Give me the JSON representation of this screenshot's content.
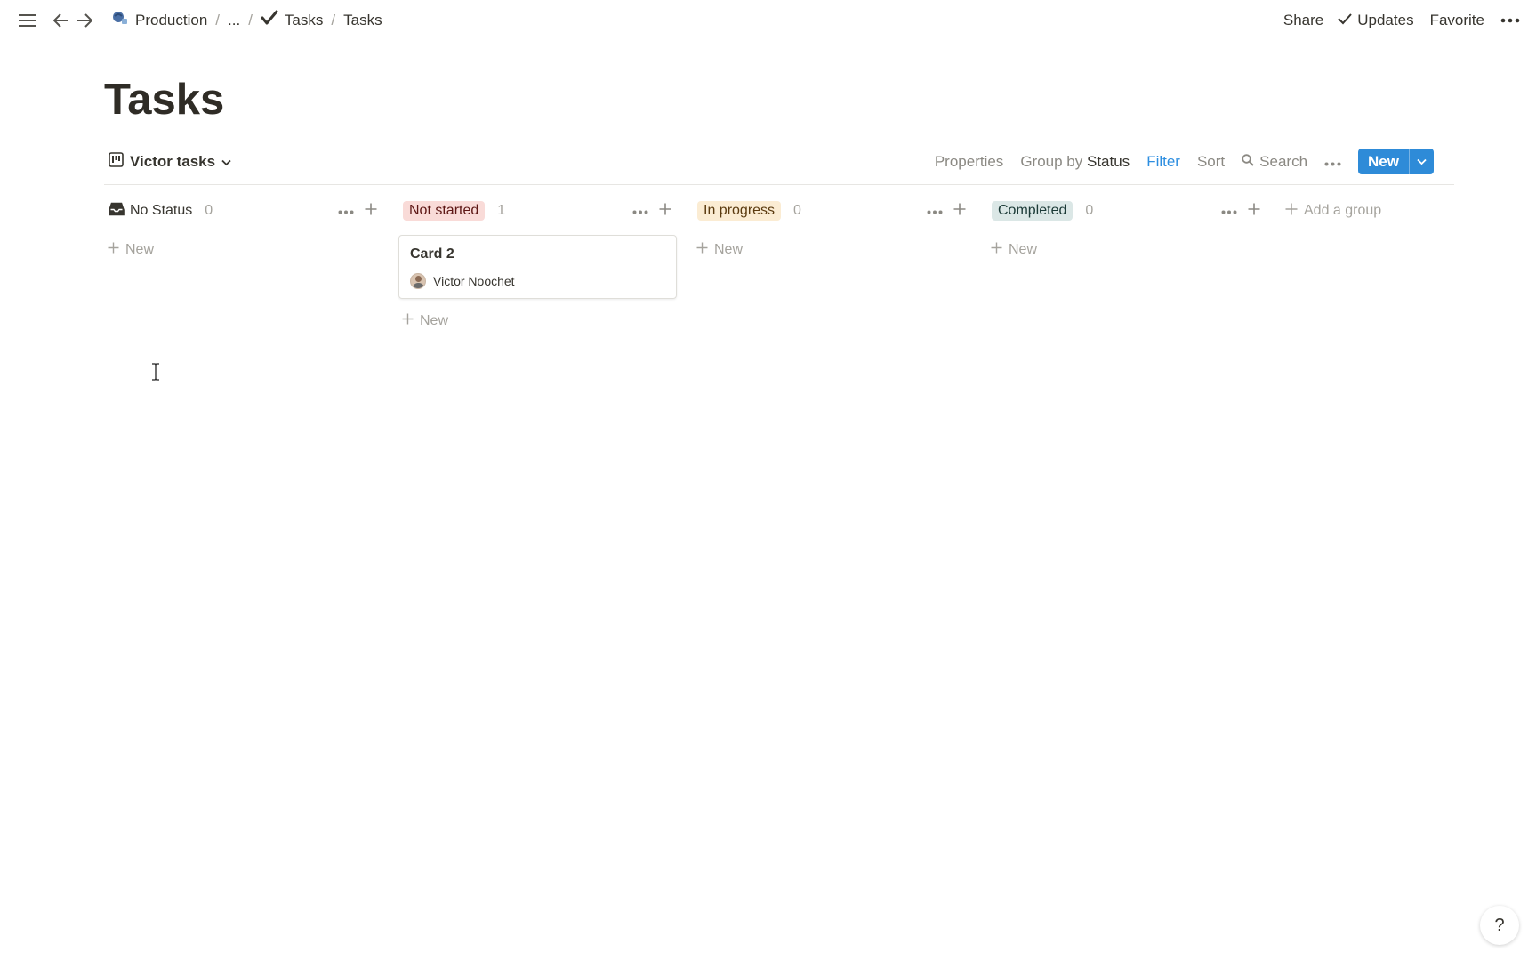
{
  "topbar": {
    "breadcrumbs": [
      {
        "label": "Production",
        "icon": "workspace-icon"
      },
      {
        "label": "..."
      },
      {
        "label": "Tasks",
        "icon": "checkmark-icon"
      },
      {
        "label": "Tasks"
      }
    ],
    "share_label": "Share",
    "updates_label": "Updates",
    "favorite_label": "Favorite"
  },
  "page": {
    "title": "Tasks"
  },
  "viewbar": {
    "view_name": "Victor tasks",
    "properties_label": "Properties",
    "group_by_label": "Group by",
    "group_by_value": "Status",
    "filter_label": "Filter",
    "sort_label": "Sort",
    "search_label": "Search",
    "new_label": "New"
  },
  "board": {
    "columns": [
      {
        "name": "No Status",
        "count": "0",
        "color": "",
        "text_color": "#37352f"
      },
      {
        "name": "Not started",
        "count": "1",
        "color": "#f9dbd8",
        "text_color": "#5d1715"
      },
      {
        "name": "In progress",
        "count": "0",
        "color": "#fbecd3",
        "text_color": "#5b3b10"
      },
      {
        "name": "Completed",
        "count": "0",
        "color": "#dbe7e6",
        "text_color": "#1b3a37"
      }
    ],
    "new_label": "New",
    "add_group_label": "Add a group",
    "cards": [
      {
        "column": "Not started",
        "title": "Card 2",
        "assignee": "Victor Noochet"
      }
    ]
  },
  "help": {
    "label": "?"
  },
  "colors": {
    "accent": "#2e8bd8",
    "filter_active": "#2d8ee0"
  }
}
